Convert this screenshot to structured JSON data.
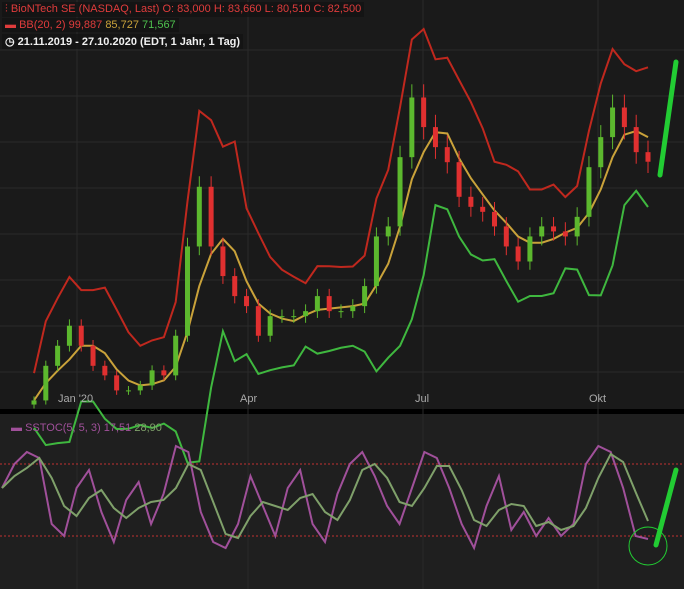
{
  "header": {
    "title": "BioNTech SE (NASDAQ, Last)",
    "open": "O: 83,000",
    "high": "H: 83,660",
    "low": "L: 80,510",
    "close": "C: 82,500",
    "bb_label": "BB(20, 2)",
    "bb_upper": "99,887",
    "bb_mid": "85,727",
    "bb_lower": "71,567",
    "range": "21.11.2019 - 27.10.2020",
    "range_info": "(EDT, 1 Jahr, 1 Tag)"
  },
  "stoch": {
    "label": "SSTOC(5, 5, 3)",
    "k": "17,51",
    "d": "28,90"
  },
  "colors": {
    "price_up": "#5cb82e",
    "price_down": "#e03030",
    "bb_upper": "#c0281e",
    "bb_mid": "#c9a23a",
    "bb_lower": "#3fb83f",
    "stoch_k": "#a0509a",
    "stoch_d": "#7fa06a",
    "annotation": "#22cc33"
  },
  "chart_data": [
    {
      "type": "candlestick",
      "title": "BioNTech SE (NASDAQ, Last)",
      "x_ticks": [
        "Jan '20",
        "Apr",
        "Jul",
        "Okt"
      ],
      "ylim": [
        28,
        118
      ],
      "closes": [
        30.1,
        37.7,
        42.1,
        46.5,
        42.1,
        37.7,
        35.6,
        32.3,
        32.3,
        33.4,
        36.7,
        35.6,
        44.3,
        63.9,
        77.0,
        63.9,
        57.4,
        53.0,
        50.8,
        44.3,
        48.6,
        48.6,
        48.6,
        49.7,
        53.0,
        49.7,
        49.7,
        50.8,
        55.2,
        66.1,
        68.3,
        83.5,
        96.6,
        90.1,
        85.7,
        82.4,
        74.8,
        72.6,
        71.5,
        68.3,
        63.9,
        60.6,
        66.1,
        68.3,
        67.2,
        66.1,
        70.4,
        81.3,
        87.9,
        94.4,
        90.1,
        84.6,
        82.5
      ],
      "bollinger": {
        "period": 20,
        "stddev": 2,
        "last": {
          "upper": 99.887,
          "mid": 85.727,
          "lower": 71.567
        }
      }
    },
    {
      "type": "line",
      "title": "SSTOC(5, 5, 3)",
      "ylim": [
        0,
        100
      ],
      "levels": [
        20,
        80
      ],
      "k": [
        60,
        80,
        90,
        85,
        30,
        20,
        60,
        75,
        40,
        15,
        50,
        65,
        30,
        55,
        95,
        90,
        40,
        15,
        10,
        30,
        70,
        45,
        20,
        60,
        75,
        30,
        15,
        55,
        80,
        90,
        70,
        45,
        30,
        60,
        90,
        85,
        60,
        30,
        10,
        45,
        70,
        25,
        40,
        20,
        35,
        20,
        30,
        80,
        95,
        90,
        60,
        20,
        17.51
      ],
      "d_last": 28.9
    }
  ]
}
